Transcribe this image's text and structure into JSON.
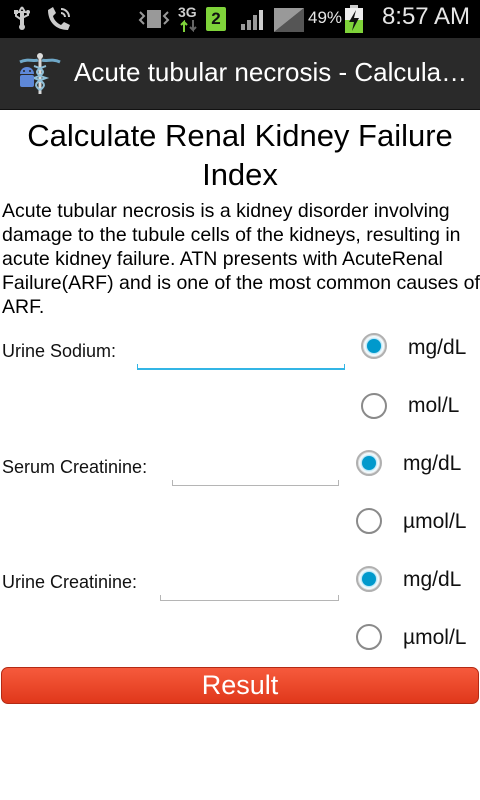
{
  "status_bar": {
    "time": "8:57 AM",
    "battery_percent": "49%",
    "network_type": "3G",
    "notification_count": "2",
    "icons": [
      "usb-icon",
      "phone-icon",
      "vibrate-icon",
      "data-icon",
      "notification-icon",
      "signal-icon",
      "signal-icon-2",
      "battery-charging-icon"
    ]
  },
  "action_bar": {
    "title": "Acute tubular necrosis - Calculate Renal Kidney Failure Index",
    "icon": "caduceus-android-icon"
  },
  "main": {
    "title": "Calculate Renal Kidney Failure Index",
    "description": "Acute tubular necrosis is a kidney disorder involving damage to the tubule cells of the kidneys, resulting in acute kidney failure. ATN presents with AcuteRenal Failure(ARF) and is one of the most common causes of ARF.",
    "fields": [
      {
        "label": "Urine Sodium:",
        "value": "",
        "units": [
          "mg/dL",
          "mol/L"
        ],
        "selected_unit": "mg/dL"
      },
      {
        "label": "Serum Creatinine:",
        "value": "",
        "units": [
          "mg/dL",
          "µmol/L"
        ],
        "selected_unit": "mg/dL"
      },
      {
        "label": "Urine Creatinine:",
        "value": "",
        "units": [
          "mg/dL",
          "µmol/L"
        ],
        "selected_unit": "mg/dL"
      }
    ],
    "result_button": "Result"
  },
  "colors": {
    "accent": "#33b5e5",
    "radio_checked": "#0099cc",
    "button": "#e9442a",
    "status_bar": "#000000",
    "action_bar": "#2a2a2a"
  }
}
